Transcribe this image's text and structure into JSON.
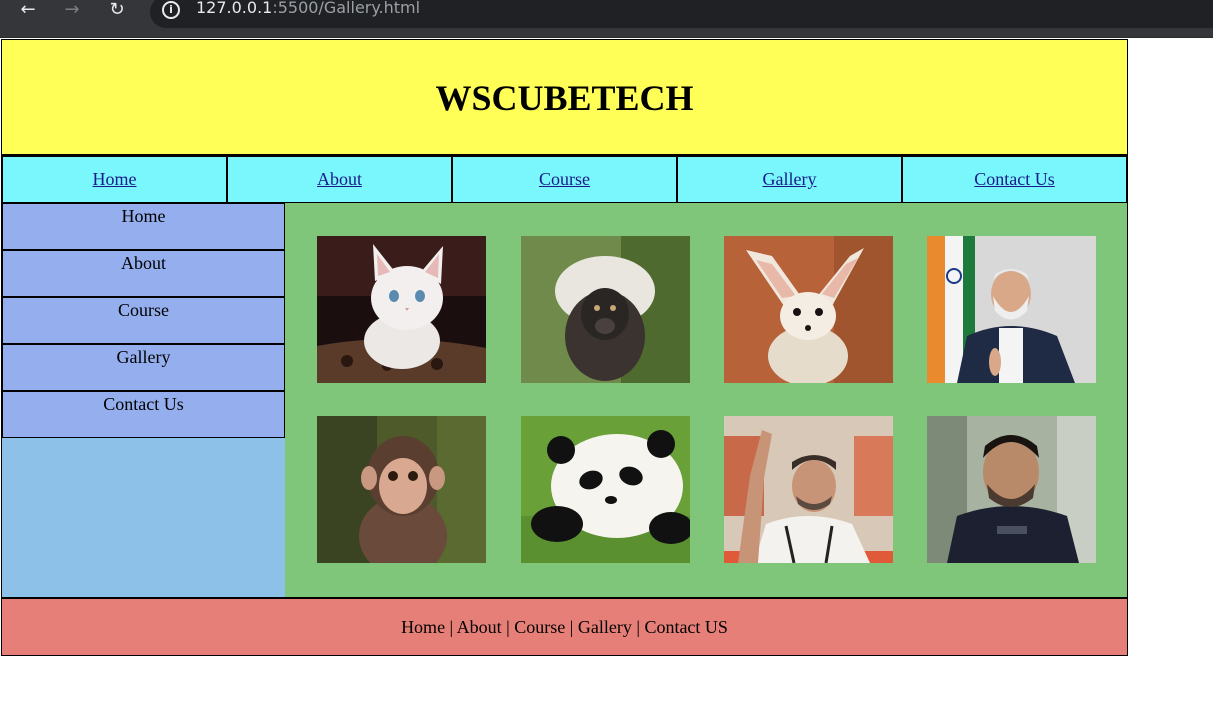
{
  "browser": {
    "url_host": "127.0.0.1",
    "url_path": ":5500/Gallery.html",
    "back_icon": "arrow-left-icon",
    "forward_icon": "arrow-right-icon",
    "reload_icon": "reload-icon",
    "info_icon": "info-icon"
  },
  "header": {
    "title": "WSCUBETECH",
    "background": "#ffff57"
  },
  "topnav": {
    "background": "#7af7fc",
    "items": [
      {
        "label": "Home"
      },
      {
        "label": "About"
      },
      {
        "label": "Course"
      },
      {
        "label": "Gallery"
      },
      {
        "label": "Contact Us"
      }
    ]
  },
  "sidebar": {
    "background": "#8ec1e8",
    "item_background": "#94aeee",
    "items": [
      {
        "label": "Home"
      },
      {
        "label": "About"
      },
      {
        "label": "Course"
      },
      {
        "label": "Gallery"
      },
      {
        "label": "Contact Us"
      }
    ]
  },
  "gallery": {
    "background": "#7fc67a",
    "images": [
      {
        "name": "kitten-photo"
      },
      {
        "name": "fluffy-monkey-photo"
      },
      {
        "name": "fennec-fox-photo"
      },
      {
        "name": "man-with-flag-photo"
      },
      {
        "name": "baby-monkey-photo"
      },
      {
        "name": "panda-photo"
      },
      {
        "name": "man-speaking-photo"
      },
      {
        "name": "man-portrait-photo"
      }
    ]
  },
  "footer": {
    "text": "Home | About | Course | Gallery | Contact US",
    "background": "#e67f78"
  }
}
